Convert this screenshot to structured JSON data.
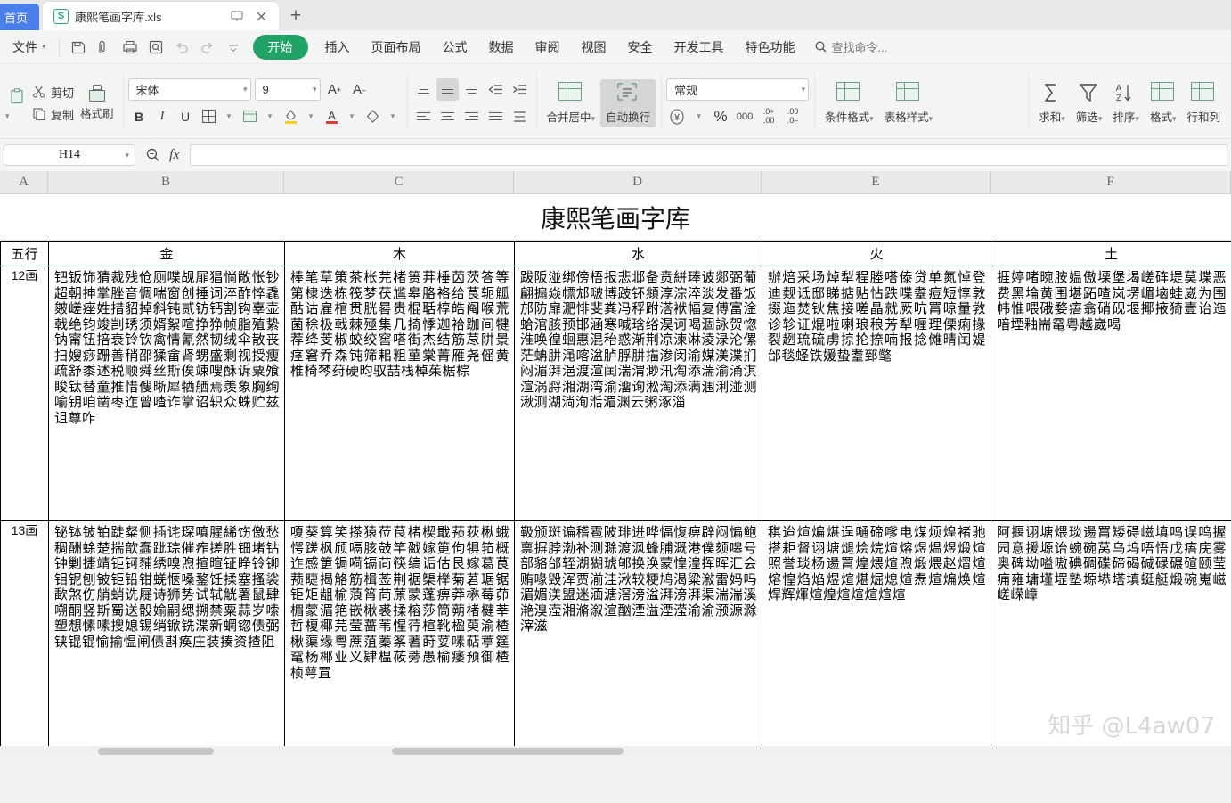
{
  "window": {
    "tabs": [
      {
        "label": "首页",
        "type": "home"
      },
      {
        "label": "康熙笔画字库.xls",
        "badge": "S",
        "type": "doc"
      }
    ],
    "new_tab_label": "+"
  },
  "menubar": {
    "file_label": "文件",
    "quick_icons": [
      "save-icon",
      "save-as-icon",
      "print-icon",
      "print-preview-icon",
      "undo-icon",
      "redo-icon",
      "customize-icon"
    ],
    "tabs": [
      "开始",
      "插入",
      "页面布局",
      "公式",
      "数据",
      "审阅",
      "视图",
      "安全",
      "开发工具",
      "特色功能"
    ],
    "active_tab": "开始",
    "search_placeholder": "查找命令..."
  },
  "ribbon": {
    "clipboard": {
      "cut": "剪切",
      "copy": "复制",
      "format_painter": "格式刷"
    },
    "font": {
      "family": "宋体",
      "size": "9",
      "bold": "B",
      "italic": "I",
      "underline": "U"
    },
    "alignment": {
      "merge_center": "合并居中",
      "wrap_text": "自动换行"
    },
    "number": {
      "format": "常规",
      "percent": "%",
      "comma": "000"
    },
    "styles": {
      "conditional": "条件格式",
      "table_style": "表格样式"
    },
    "editing": {
      "sum": "求和",
      "filter": "筛选",
      "sort": "排序",
      "format": "格式",
      "rows_cols": "行和列"
    }
  },
  "formula_bar": {
    "name_box": "H14",
    "formula_value": ""
  },
  "grid": {
    "columns": [
      "A",
      "B",
      "C",
      "D",
      "E",
      "F"
    ],
    "title": "康熙笔画字库",
    "headers": [
      "五行",
      "金",
      "木",
      "水",
      "火",
      "土"
    ],
    "rows": [
      {
        "label": "12画",
        "cells": [
          "钯钣饰猜裁残伧厕喋觇屝猖惝敞怅钞超朝抻掌脞音惆喘窗创捶词淬酢悴毳皴嵯痤姓措貂掉斜钝贰钫钙割钩辜壶戟绝钧竣剀琇须婿絮喧挣狰帧脂殖絷钠甯钮掊衰铃钦禽情氰然韧绒伞散丧扫嫂痧跚善稍邵猱畲肾甥盛剩视授瘦疏舒黍述税顺舜丝斯俟竦嗖酥诉粟飧睃钛替童推惜傁晰犀牺舾焉羡象胸绚喻钥咱凿枣迮曾喳诈掌诏轵众蛛贮兹诅尊咋",
          "棒笔草策茶枨芫楮篑荓棰苬茨答等第棣迭栋筏梦茯尴皋胳袼给茛轭觚酤诂雇棺贯胱晷贵棍聒椁皓阄喉荒菌稌极戟棘殛集几掎悸迦袷跏间犍荐绛芰椒蛟绞窖嗒街杰结筋荩阱景痉窘乔森钝筛耜粗荲棠菁雁尧傜黄椎椅棽荮硬昀驭喆栈棹茱椐棕",
          "跋阪湴绑傍梧报悲邶备贲絣琫诐郯弼葡翩搧焱幖邥啵博跛钚頫淳淙淬淡发番饭邡防扉淝悱斐粪冯稃跗溚袱幅复傅富淦蛤涫胲预邯涵寒喊琀绤淏诃喝涸詠贺惚淮唤徨蛔惠混秮惑渐荆凉湅淋淩渌沦傫茫蚺肼渑喀湓胪脬肼描渗闵渝媒渼渫扪闷湄湃浥渡渲闰湍渭渺汛淘添湍渝涌淇渲涡脟湘湖湾渝澑询淞淘添满涠浰湴测湫测湖淌洵湉湄渊云粥涿淄",
          "辦焙采场焯犁程塍嗒傣贷单氮悼登迪觌诋邸睇掂贴怗跌喋耋痘短惇敦掇迤焚钬焦接嗟晶就厥吭罥晾量敩诊轸证焜啦喇琅稂芳犁喱理傈痢掾裂趔琉硫虏掠抡捺喃报捻傩晴闰媞邰毯蛏铁媛蛰耋郅氅",
          "捱婷啫晼胺媪傲塛堡堨嵯砗堤莫堞恶费黑埨黄围堪跖喳岚塄嵋垴蛙崴为围帏惟喂硪婺痦翕硝砚堰揶掖猗壹诒迤喑堙釉耑鼋粤越崴喝"
        ]
      },
      {
        "label": "13画",
        "cells": [
          "铋钵铍铂跿粲恻插诧琛嗔腥絺饬儌愁稠酬蜍楚揣歆蠢跐琮催痄搓胜钿堵钴钟剿捷靖钜钶豧绣嗅煦揎暄钲睁铃铆钼铌刨铍钜铅钳蜣愜嗓鍪饪揉塞搔裟歃煞伤艄蛸诜屣诗狮势试轼觥署鼠肆嗍酮竖斯蜀送骰媮嗣缌搠禁粟蒜岁嗦塑想愫嗉搜媳锡绡锨铣渫新蝄锪债弼铗锟锟愉揄愠闸债斟痪庄装揍资揸阻",
          "嗄葵算笑搽猿莅茛楮楔戢蓣荻楸蛾愕蹉枫颀嗝胲鼓竿戤嫁筻佝犋筘概迮感筻锔嗬镉苘筷缟诟估艮嫁葛茛蓣睫揭觡筋楫莶荆裾榘榉菊莙琚锯钜矩龃榆蒗筲苘蒝蒙蓬痹莽楙莓茆楣蒙湄筢嵌楸裘揉榕莎筒蒴楮楗莘哲榎椰芫莹蔷苇惺荇楦靴楹萸渝楂楸蕖缘粤蔗菹蓁筿蓍莳荽嗉萜葶筳鼋杨椰业义肄榅莜蒡愚榆痿预御楂桢萼罝",
          "靸颁斑谝稽雹陂琲逬哗愊愎痹辟闷惼鲍禀摒脖渤补测滁渡沨蜂脯溉港僕颏嗥号部貉邰轾湖猢琥郇换涣蒙惶湟挥晖汇会贿喙毁浑贾湔洼湫较粳鸠渴粱潊雷妈吗湄媚渼盟迷湎溏滘滂湓湃滂湃渠湍湍溪滟溴滢湘滫溆渲酗湮溢湮滢渝渝滪源滁滓滋",
          "稘迨煊煸煁逞嗵碲嗲电煤烦煌褚驰搭耟督诩塘煺烩烷煊熔煜煴煜煅煊照誉琰杨逿罥煌煨煊煦煅煨赵熠煊熔惶焰焰煜煊煁煀熄煊焘煊煸焕煊焊辉煇煊煌煊煊煊煊煊",
          "阿揠诩塘煨琰逿罥矮碍嵫填呜误鸣握园意援塬诒蜿碗莴乌坞唔悟戊痦庑雾奥碑坳嗌嗷碘碉碟碲碣碱碌碾碹颐莹痈雍墉墐堽塾塬塨塔填蜓艇煅碗嵬嵫嵯嵘嶂"
        ]
      }
    ],
    "watermark": "知乎 @L4aw07"
  }
}
